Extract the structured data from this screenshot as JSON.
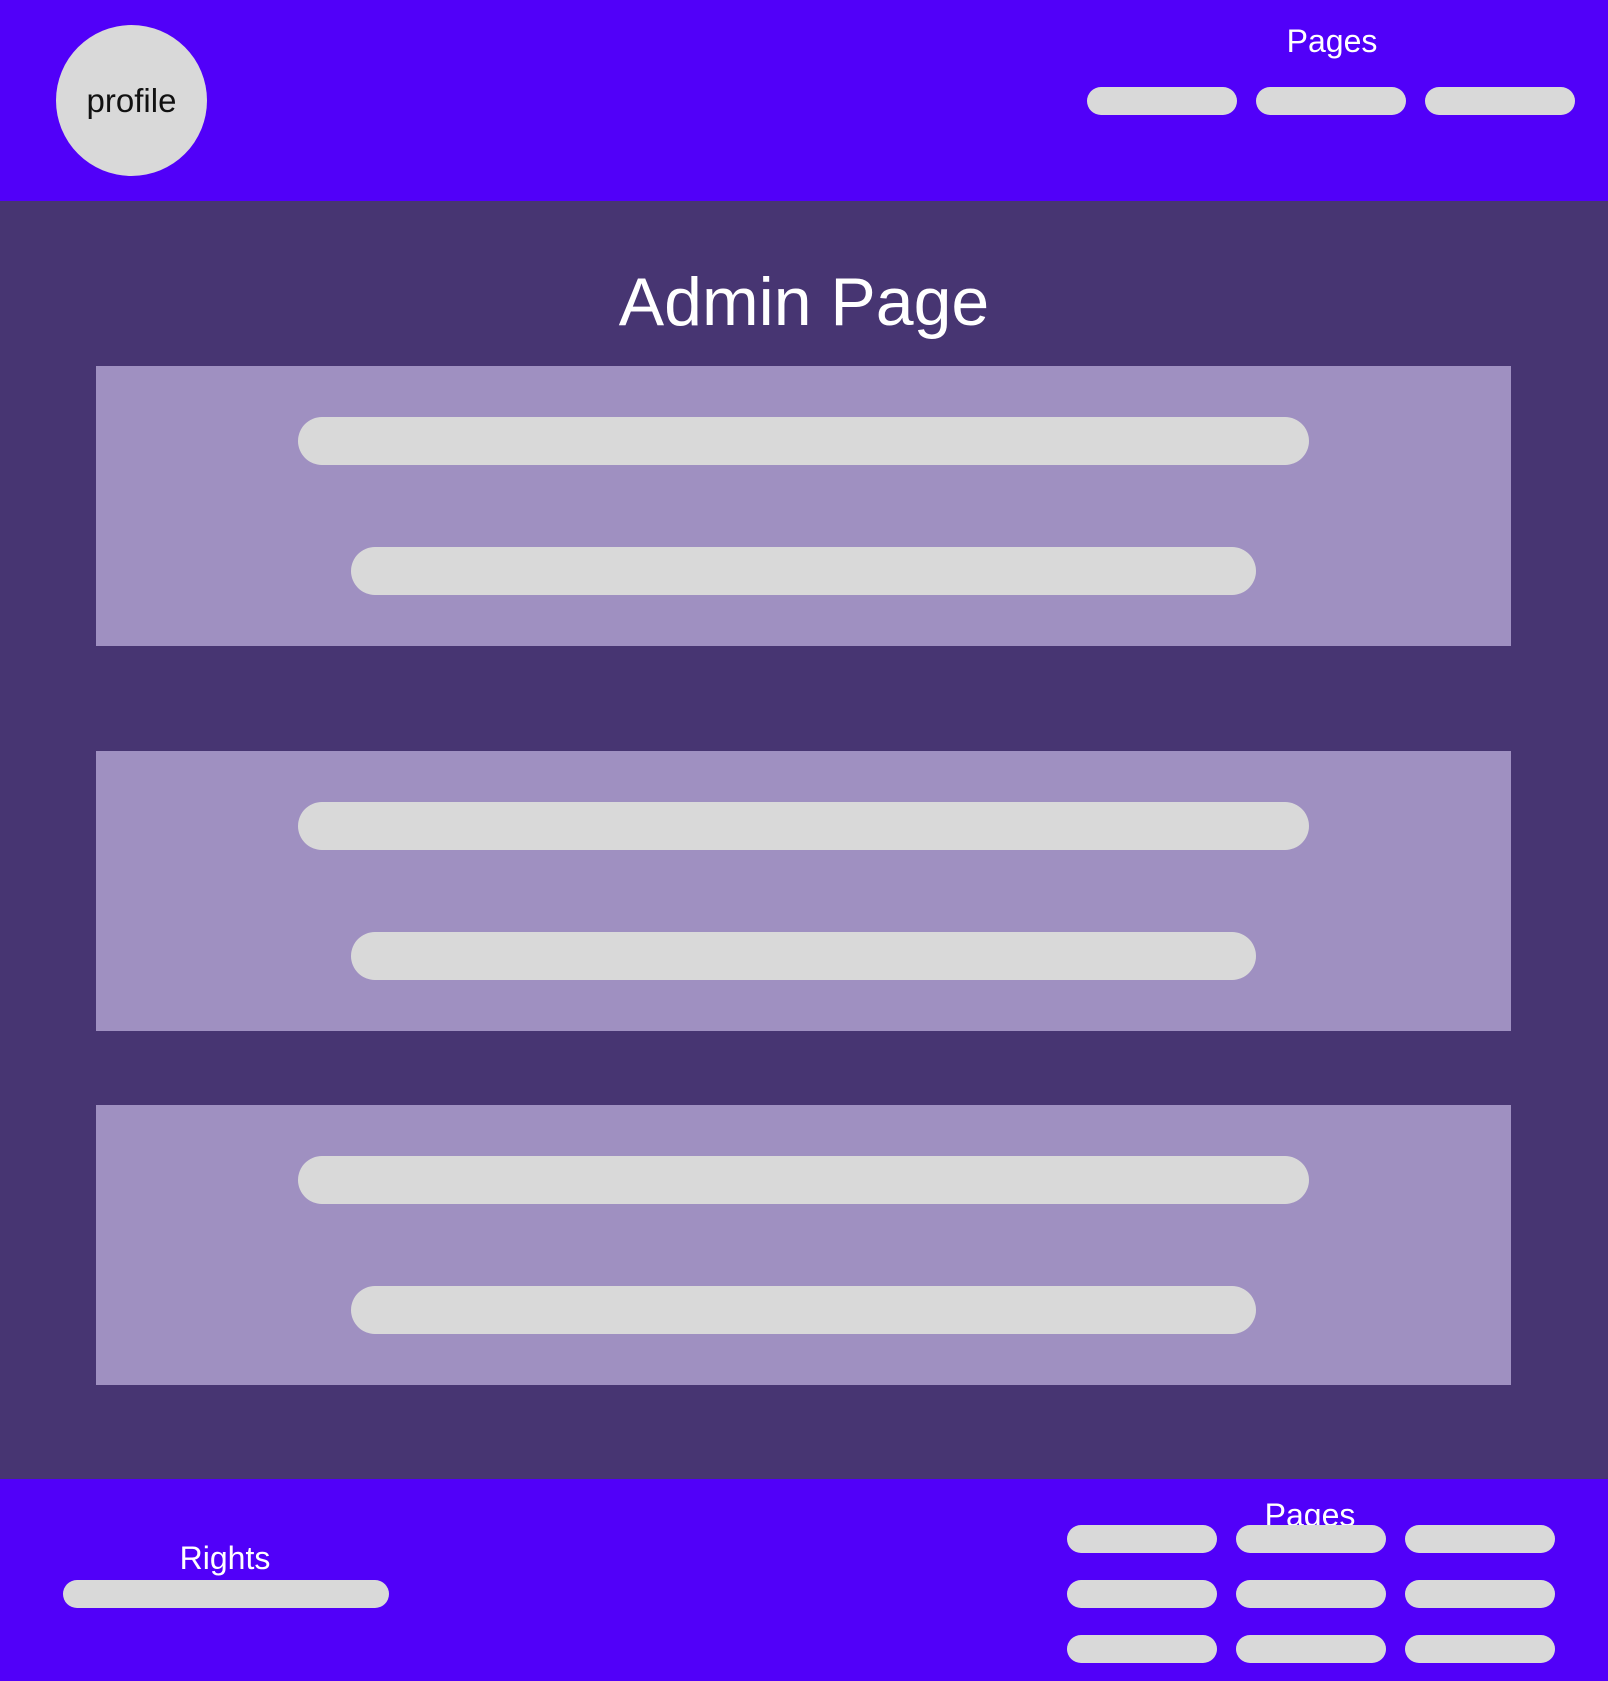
{
  "header": {
    "profile_label": "profile",
    "nav_heading": "Pages",
    "nav_items": 3
  },
  "main": {
    "title": "Admin Page",
    "panels": 3
  },
  "footer": {
    "rights_label": "Rights",
    "nav_heading": "Pages",
    "nav_rows": 3,
    "nav_cols": 3
  },
  "colors": {
    "header_footer_bg": "#5100f9",
    "main_bg": "#473572",
    "panel_bg": "#9f90c1",
    "placeholder": "#d9d9d9",
    "text_light": "#ffffff"
  }
}
